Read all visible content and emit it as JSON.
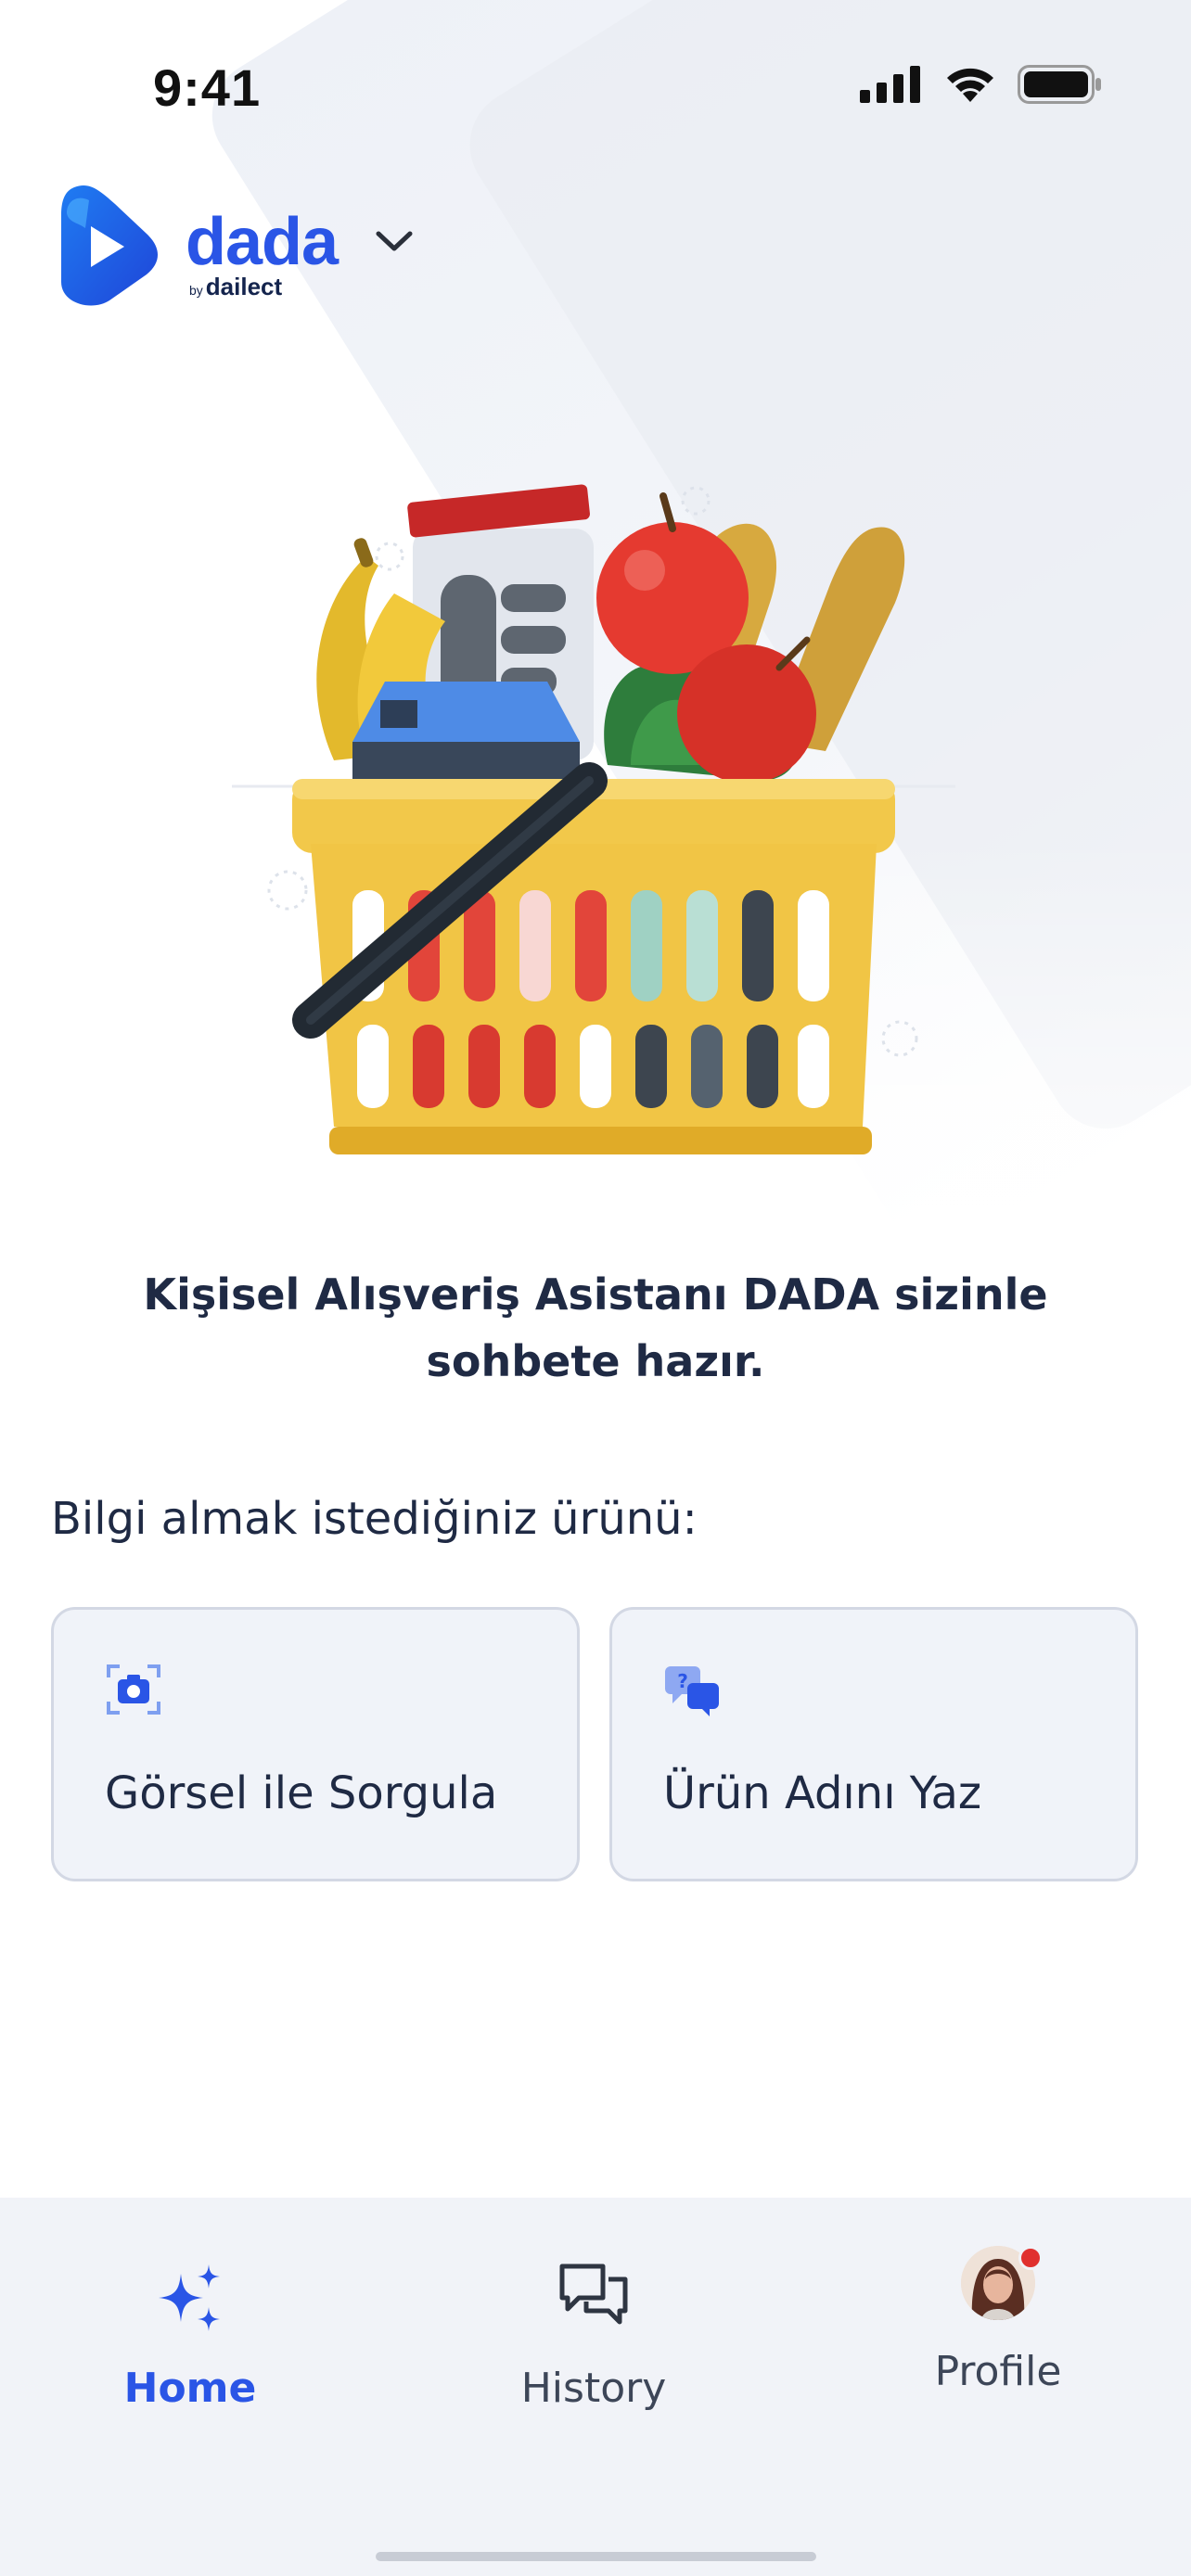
{
  "status_bar": {
    "time": "9:41"
  },
  "header": {
    "brand_name": "dada",
    "brand_by": "by",
    "brand_company": "dailect"
  },
  "tagline": "Kişisel Alışveriş Asistanı DADA sizinle sohbete hazır.",
  "section_label": "Bilgi almak istediğiniz ürünü:",
  "options": [
    {
      "label": "Görsel ile Sorgula",
      "icon": "camera-scan-icon"
    },
    {
      "label": "Ürün Adını Yaz",
      "icon": "chat-question-icon"
    }
  ],
  "bottom_nav": {
    "items": [
      {
        "label": "Home",
        "icon": "sparkles-icon",
        "active": true
      },
      {
        "label": "History",
        "icon": "chat-bubbles-icon",
        "active": false
      },
      {
        "label": "Profile",
        "icon": "avatar",
        "active": false
      }
    ]
  },
  "colors": {
    "accent": "#2a55e6",
    "text": "#1f2a44",
    "card_bg": "#f0f3f9",
    "nav_bg": "#f1f3f8"
  }
}
